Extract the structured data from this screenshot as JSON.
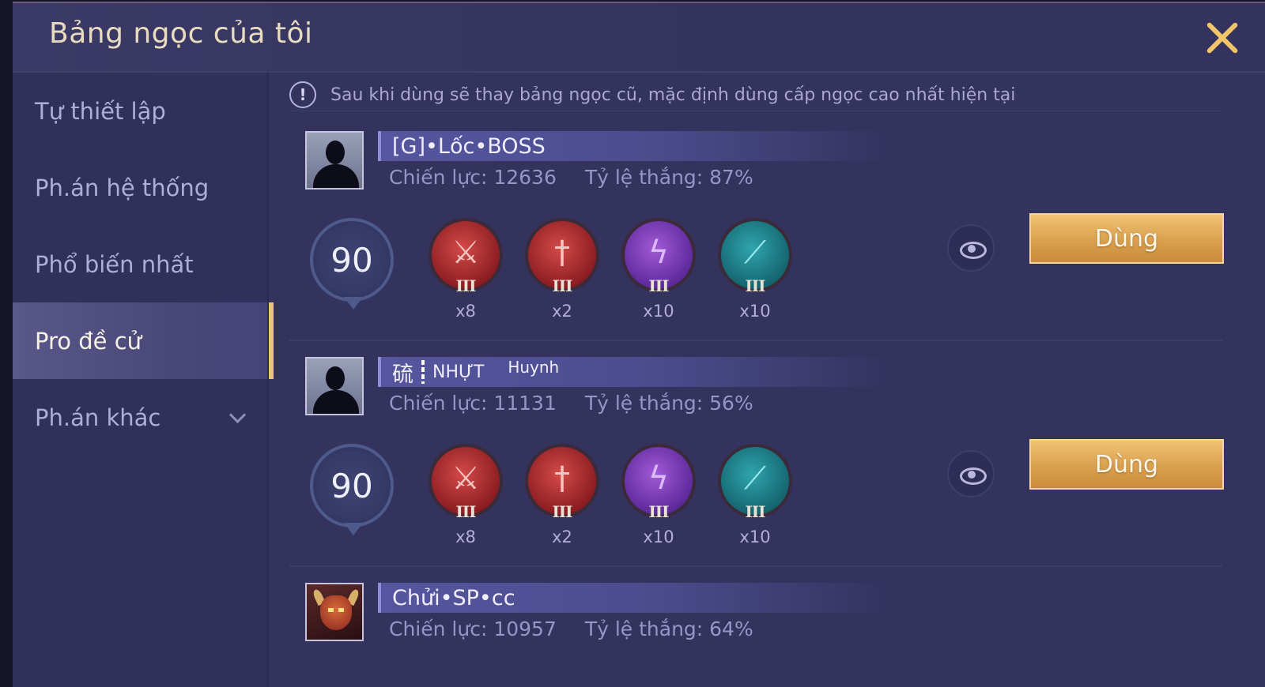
{
  "window": {
    "title": "Bảng ngọc của tôi"
  },
  "sidebar": {
    "items": [
      {
        "label": "Tự thiết lập"
      },
      {
        "label": "Ph.án hệ thống"
      },
      {
        "label": "Phổ biến nhất"
      },
      {
        "label": "Pro đề cử"
      },
      {
        "label": "Ph.án khác"
      }
    ],
    "active_index": 3
  },
  "notice": {
    "text": "Sau khi dùng sẽ thay bảng ngọc cũ, mặc định dùng cấp ngọc cao nhất hiện tại"
  },
  "players": [
    {
      "name": "[G]•Lốc•BOSS",
      "power": "Chiến lực: 12636",
      "winrate": "Tỷ lệ thắng: 87%",
      "level": "90",
      "gems": [
        {
          "icon": "red-sword-gem",
          "tier": "III",
          "count": "x8"
        },
        {
          "icon": "red-dagger-gem",
          "tier": "III",
          "count": "x2"
        },
        {
          "icon": "purple-lightning-gem",
          "tier": "III",
          "count": "x10"
        },
        {
          "icon": "teal-blade-gem",
          "tier": "III",
          "count": "x10"
        }
      ],
      "use_label": "Dùng"
    },
    {
      "name_a": "硫",
      "name_b": "NHỰT",
      "name_sub": "Huynh",
      "power": "Chiến lực: 11131",
      "winrate": "Tỷ lệ thắng: 56%",
      "level": "90",
      "gems": [
        {
          "icon": "red-sword-gem",
          "tier": "III",
          "count": "x8"
        },
        {
          "icon": "red-dagger-gem",
          "tier": "III",
          "count": "x2"
        },
        {
          "icon": "purple-lightning-gem",
          "tier": "III",
          "count": "x10"
        },
        {
          "icon": "teal-blade-gem",
          "tier": "III",
          "count": "x10"
        }
      ],
      "use_label": "Dùng"
    },
    {
      "name": "Chửi•SP•cc",
      "power": "Chiến lực: 10957",
      "winrate": "Tỷ lệ thắng: 64%"
    }
  ],
  "colors": {
    "panel": "#33335e",
    "accent_gold": "#e7c57c",
    "button_gold": "#d9a04f"
  }
}
